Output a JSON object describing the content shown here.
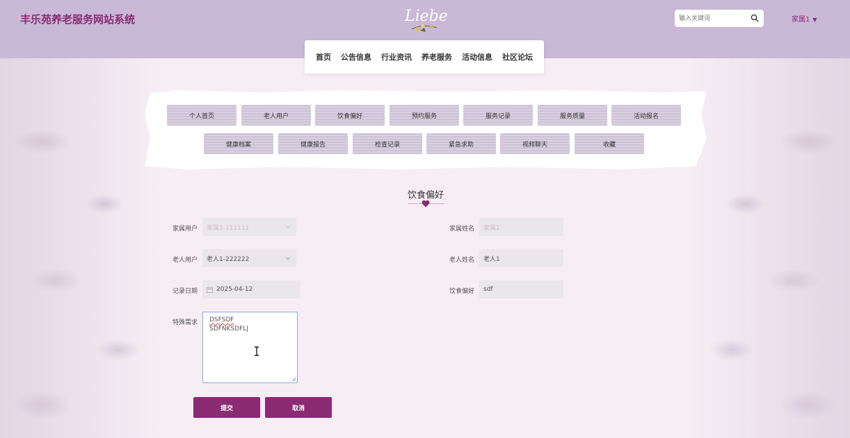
{
  "header": {
    "site_title": "丰乐苑养老服务网站系统",
    "logo_text": "Liebe",
    "search": {
      "placeholder": "输入关键词",
      "icon": "search-icon"
    },
    "user": {
      "label": "家属1",
      "caret": "▼"
    }
  },
  "nav": {
    "items": [
      "首页",
      "公告信息",
      "行业资讯",
      "养老服务",
      "活动信息",
      "社区论坛"
    ]
  },
  "menu": {
    "row1": [
      "个人首页",
      "老人用户",
      "饮食偏好",
      "预约服务",
      "服务记录",
      "服务质量",
      "活动报名"
    ],
    "row2": [
      "健康档案",
      "健康报告",
      "检查记录",
      "紧急求助",
      "视频聊天",
      "收藏"
    ]
  },
  "section": {
    "title": "饮食偏好"
  },
  "form": {
    "family_user": {
      "label": "家属用户",
      "value": "家属1-111111"
    },
    "family_name": {
      "label": "家属姓名",
      "value": "家属1"
    },
    "elder_user": {
      "label": "老人用户",
      "value": "老人1-222222"
    },
    "elder_name": {
      "label": "老人姓名",
      "value": "老人1"
    },
    "record_date": {
      "label": "记录日期",
      "value": "2025-04-12"
    },
    "diet_pref": {
      "label": "饮食偏好",
      "value": "sdf"
    },
    "special_needs": {
      "label": "特殊需求",
      "line1": "DSFSDF",
      "line2": "SDFNKSDFL"
    }
  },
  "buttons": {
    "submit": "提交",
    "cancel": "取消"
  },
  "colors": {
    "brand": "#8a2b74",
    "header_bg": "#c9b8d6",
    "page_bg": "#f7eef5"
  }
}
